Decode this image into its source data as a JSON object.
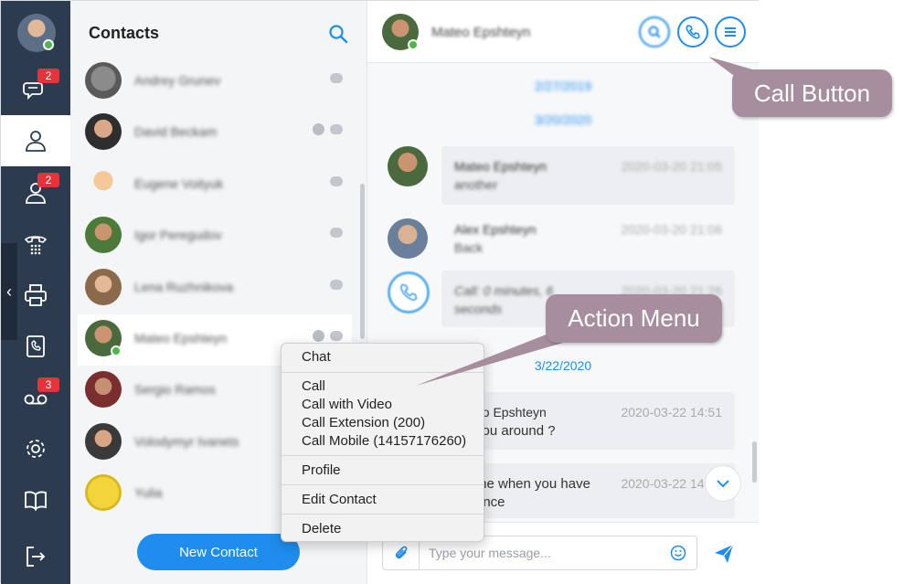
{
  "nav": {
    "badges": {
      "chats": "2",
      "contacts": "2",
      "voicemail": "3"
    },
    "collapse_glyph": "‹"
  },
  "contacts": {
    "title": "Contacts",
    "items": [
      {
        "name": "Andrey Grunev",
        "globe": false
      },
      {
        "name": "David Beckam",
        "globe": true
      },
      {
        "name": "Eugene Voityuk",
        "globe": false
      },
      {
        "name": "Igor Peregudov",
        "globe": false
      },
      {
        "name": "Lena Ruzhnikova",
        "globe": false
      },
      {
        "name": "Mateo Epshteyn",
        "globe": true,
        "selected": true
      },
      {
        "name": "Sergio Ramos",
        "globe": false
      },
      {
        "name": "Volodymyr Ivanets",
        "globe": false
      },
      {
        "name": "Yulia",
        "globe": false
      }
    ],
    "new_contact_label": "New Contact"
  },
  "chat": {
    "contact_name": "Mateo Epshteyn",
    "dates": [
      "2/27/2019",
      "3/20/2020",
      "3/22/2020"
    ],
    "messages": [
      {
        "name": "Mateo Epshteyn",
        "text": "another",
        "time": "2020-03-20 21:05"
      },
      {
        "name": "Alex Epshteyn",
        "text": "Back",
        "time": "2020-03-20 21:06"
      },
      {
        "name": "",
        "text": "Call: 0 minutes, 6 seconds",
        "time": "2020-03-20 21:26"
      },
      {
        "name": "eo Epshteyn",
        "text": "you around ?",
        "time": "2020-03-22 14:51"
      },
      {
        "name": "",
        "text": "me when you have",
        "text2": "ance",
        "time": "2020-03-22 14:52"
      }
    ],
    "composer_placeholder": "Type your message..."
  },
  "context_menu": {
    "items": [
      "Chat",
      "Call",
      "Call with Video",
      "Call Extension (200)",
      "Call Mobile (14157176260)",
      "Profile",
      "Edit Contact",
      "Delete"
    ]
  },
  "callouts": {
    "call_button": "Call Button",
    "action_menu": "Action Menu"
  },
  "colors": {
    "accent": "#1f8ded",
    "nav_bg": "#2c3b4e",
    "badge": "#e5333b",
    "callout": "#a78e9e",
    "online": "#4cb847"
  }
}
